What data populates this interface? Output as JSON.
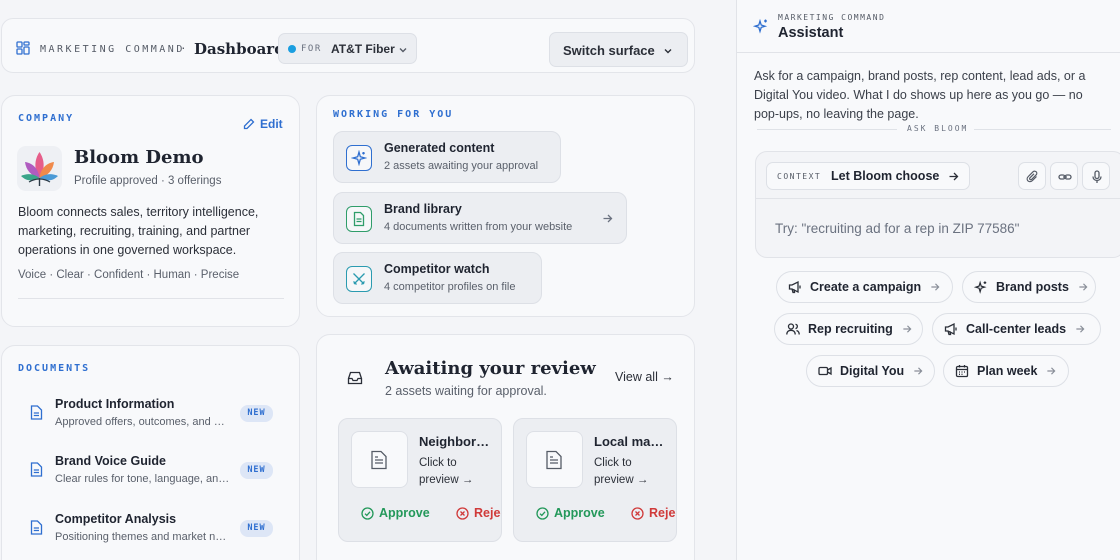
{
  "topbar": {
    "brand": "MARKETING COMMAND",
    "separator": "·",
    "title": "Dashboard",
    "for_label": "FOR",
    "for_value": "AT&T Fiber",
    "switch_label": "Switch surface"
  },
  "company": {
    "section_label": "COMPANY",
    "edit_label": "Edit",
    "name": "Bloom Demo",
    "meta": "Profile approved · 3 offerings",
    "description": "Bloom connects sales, territory intelligence, marketing, recruiting, training, and partner operations in one governed workspace.",
    "traits": "Voice · Clear · Confident · Human · Precise"
  },
  "working": {
    "section_label": "WORKING FOR YOU",
    "items": [
      {
        "title": "Generated content",
        "subtitle": "2 assets awaiting your approval",
        "icon": "sparkle-icon"
      },
      {
        "title": "Brand library",
        "subtitle": "4 documents written from your website",
        "icon": "document-icon"
      },
      {
        "title": "Competitor watch",
        "subtitle": "4 competitor profiles on file",
        "icon": "crossed-swords-icon"
      }
    ]
  },
  "documents": {
    "section_label": "DOCUMENTS",
    "items": [
      {
        "title": "Product Information",
        "subtitle": "Approved offers, outcomes, and pricing",
        "badge": "NEW"
      },
      {
        "title": "Brand Voice Guide",
        "subtitle": "Clear rules for tone, language, and style",
        "badge": "NEW"
      },
      {
        "title": "Competitor Analysis",
        "subtitle": "Positioning themes and market notes",
        "badge": "NEW"
      }
    ]
  },
  "review": {
    "title": "Awaiting your review",
    "subtitle": "2 assets waiting for approval.",
    "view_all": "View all →",
    "assets": [
      {
        "title": "Neighborhood post",
        "preview": "Click to preview →",
        "approve": "Approve",
        "reject": "Reject"
      },
      {
        "title": "Local market ad",
        "preview": "Click to preview →",
        "approve": "Approve",
        "reject": "Reject"
      }
    ]
  },
  "assistant": {
    "eyebrow": "MARKETING COMMAND",
    "title": "Assistant",
    "intro": "Ask for a campaign, brand posts, rep content, lead ads, or a Digital You video. What I do shows up here as you go — no pop-ups, no leaving the page.",
    "ask_label": "ASK BLOOM",
    "context_label": "CONTEXT",
    "context_value": "Let Bloom choose",
    "input_placeholder": "Try: \"recruiting ad for a rep in ZIP 77586\"",
    "chips": [
      {
        "label": "Create a campaign",
        "icon": "megaphone-icon"
      },
      {
        "label": "Brand posts",
        "icon": "sparkle-icon"
      },
      {
        "label": "Rep recruiting",
        "icon": "users-icon"
      },
      {
        "label": "Call-center leads",
        "icon": "megaphone-icon"
      },
      {
        "label": "Digital You",
        "icon": "video-icon"
      },
      {
        "label": "Plan week",
        "icon": "calendar-icon"
      }
    ]
  },
  "colors": {
    "accent": "#2f6fd0",
    "approve": "#23985a",
    "reject": "#d03a3a",
    "status_dot": "#1a9ee0"
  }
}
